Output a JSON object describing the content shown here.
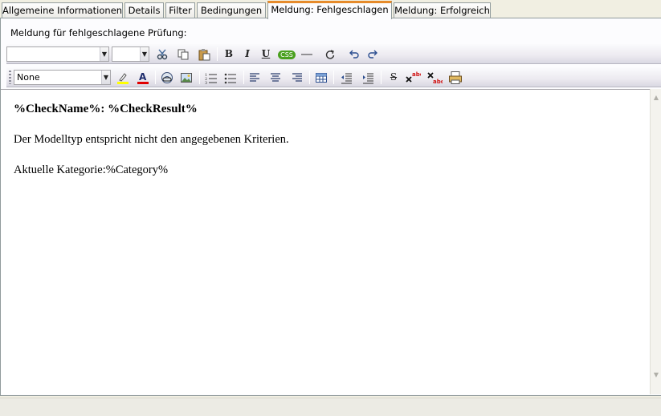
{
  "tabs": [
    {
      "label": "Allgemeine Informationen"
    },
    {
      "label": "Details"
    },
    {
      "label": "Filter"
    },
    {
      "label": "Bedingungen"
    },
    {
      "label": "Meldung: Fehlgeschlagen"
    },
    {
      "label": "Meldung: Erfolgreich"
    }
  ],
  "active_tab": "Meldung: Fehlgeschlagen",
  "panel": {
    "label": "Meldung für fehlgeschlagene Prüfung:"
  },
  "toolbar": {
    "font_name": "",
    "font_size": "",
    "style": "None",
    "bold": "B",
    "italic": "I",
    "underline": "U",
    "css": "CSS"
  },
  "editor": {
    "line1": "%CheckName%: %CheckResult%",
    "line2": "Der Modelltyp entspricht nicht den angegebenen Kriterien.",
    "line3": "Aktuelle Kategorie:%Category%"
  },
  "colors": {
    "accent_tab": "#e68b2c",
    "highlight": "#ffff00",
    "font_color": "#e00000",
    "css_badge": "#4aa01e"
  }
}
